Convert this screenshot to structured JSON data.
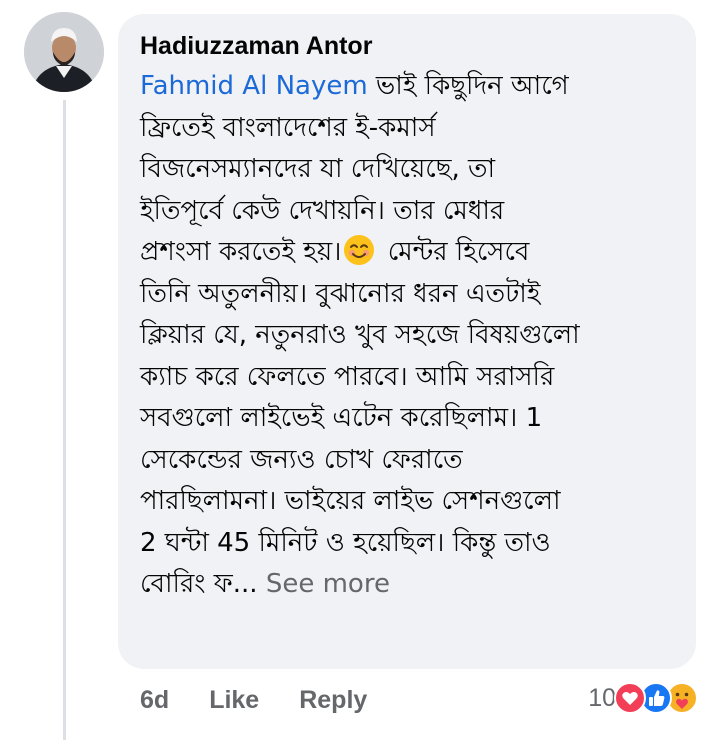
{
  "comment": {
    "author": "Hadiuzzaman Antor",
    "mention": "Fahmid Al Nayem",
    "text_before_emoji": " ভাই কিছুদিন আগে\nফ্রিতেই বাংলাদেশের ই-কমার্স\nবিজনেসম্যানদের যা দেখিয়েছে, তা\nইতিপূর্বে কেউ দেখায়নি। তার মেধার\nপ্রশংসা করতেই হয়।",
    "inline_emoji": "smiling-face-emoji",
    "text_after_emoji": " মেন্টর হিসেবে\nতিনি অতুলনীয়। বুঝানোর ধরন এতটাই\nক্লিয়ার যে, নতুনরাও খুব সহজে বিষয়গুলো\nক্যাচ করে ফেলতে পারবে। আমি সরাসরি\nসবগুলো লাইভেই এটেন করেছিলাম। 1\nসেকেন্ডের জন্যও চোখ ফেরাতে\nপারছিলামনা। ভাইয়ের লাইভ সেশনগুলো\n2 ঘন্টা 45 মিনিট ও হয়েছিল। কিন্তু তাও\nবোরিং ফ...",
    "see_more": " See more"
  },
  "actions": {
    "time": "6d",
    "like": "Like",
    "reply": "Reply"
  },
  "reactions": {
    "count": "10",
    "icons": [
      "love-reaction-icon",
      "like-reaction-icon",
      "care-reaction-icon"
    ]
  },
  "colors": {
    "bubble": "#f0f2f5",
    "mention": "#1b6ad8",
    "meta": "#65676b",
    "love": "#f33e58",
    "like": "#1877f2",
    "care": "#f7b125"
  }
}
